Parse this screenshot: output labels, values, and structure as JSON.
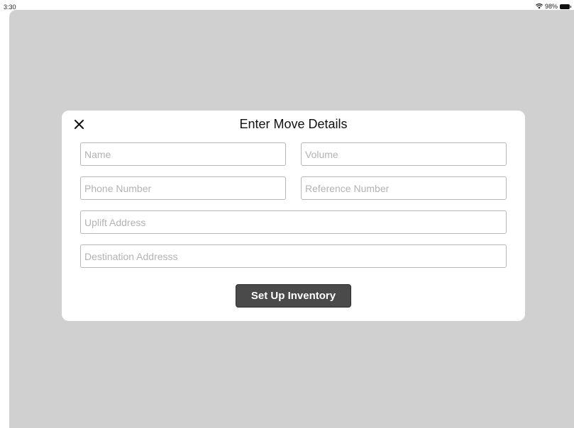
{
  "status_bar": {
    "time": "3:30",
    "battery": "98%"
  },
  "modal": {
    "title": "Enter Move Details",
    "fields": {
      "name_placeholder": "Name",
      "volume_placeholder": "Volume",
      "phone_placeholder": "Phone Number",
      "reference_placeholder": "Reference Number",
      "uplift_placeholder": "Uplift Address",
      "destination_placeholder": "Destination Addresss"
    },
    "submit_label": "Set Up Inventory"
  },
  "colors": {
    "backdrop": "#d0d0d0",
    "button_bg": "#4a4a4a",
    "modal_bg": "#ffffff"
  },
  "icons": [
    "wifi-icon",
    "battery-icon",
    "close-icon"
  ]
}
